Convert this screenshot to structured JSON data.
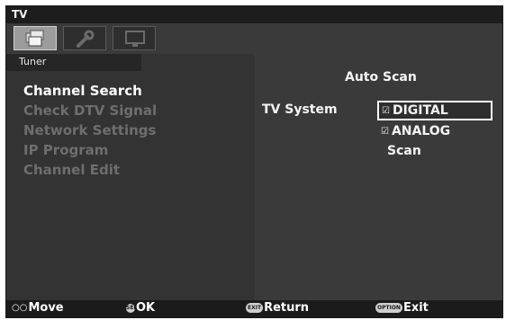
{
  "window": {
    "title": "TV"
  },
  "icon_bar": {
    "tabs": [
      {
        "icon": "tv-settings-icon",
        "active": true
      },
      {
        "icon": "wrench-icon",
        "active": false
      },
      {
        "icon": "monitor-icon",
        "active": false
      }
    ]
  },
  "left_panel": {
    "header": "Tuner",
    "items": [
      {
        "label": "Channel Search",
        "active": true
      },
      {
        "label": "Check DTV Signal",
        "active": false
      },
      {
        "label": "Network Settings",
        "active": false
      },
      {
        "label": "IP Program",
        "active": false
      },
      {
        "label": "Channel Edit",
        "active": false
      }
    ]
  },
  "right_panel": {
    "title": "Auto Scan",
    "tv_system_label": "TV System",
    "options": [
      {
        "label": "DIGITAL",
        "checkbox_glyph": "☑",
        "checked": true
      },
      {
        "label": "ANALOG",
        "checkbox_glyph": "☑",
        "checked": true
      }
    ],
    "scan_label": "Scan"
  },
  "footer": {
    "move": {
      "key": "○○",
      "label": "Move"
    },
    "ok": {
      "key": "SEL",
      "label": "OK"
    },
    "return": {
      "key": "EXIT",
      "label": "Return"
    },
    "exit": {
      "key": "OPTION",
      "label": "Exit"
    }
  },
  "colors": {
    "background": "#2b2b2b",
    "highlight_border": "#ffffff",
    "inactive_text": "#6e6e6e",
    "active_text": "#ffffff"
  }
}
